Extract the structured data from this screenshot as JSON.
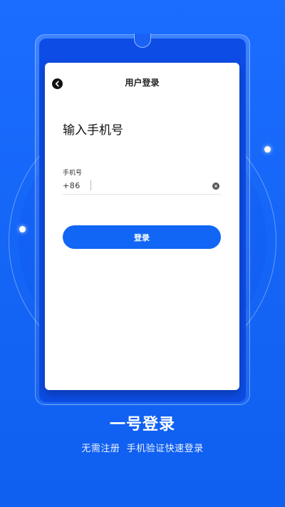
{
  "card": {
    "title": "用户登录",
    "heading": "输入手机号",
    "phone_label": "手机号",
    "country_code": "+86",
    "phone_value": "",
    "login_label": "登录"
  },
  "promo": {
    "title": "一号登录",
    "subtitle": "无需注册  手机验证快速登录"
  },
  "colors": {
    "background": "#1465f6",
    "button": "#1166f5",
    "card": "#ffffff"
  },
  "icons": {
    "back": "back-arrow-icon",
    "clear": "clear-icon"
  }
}
